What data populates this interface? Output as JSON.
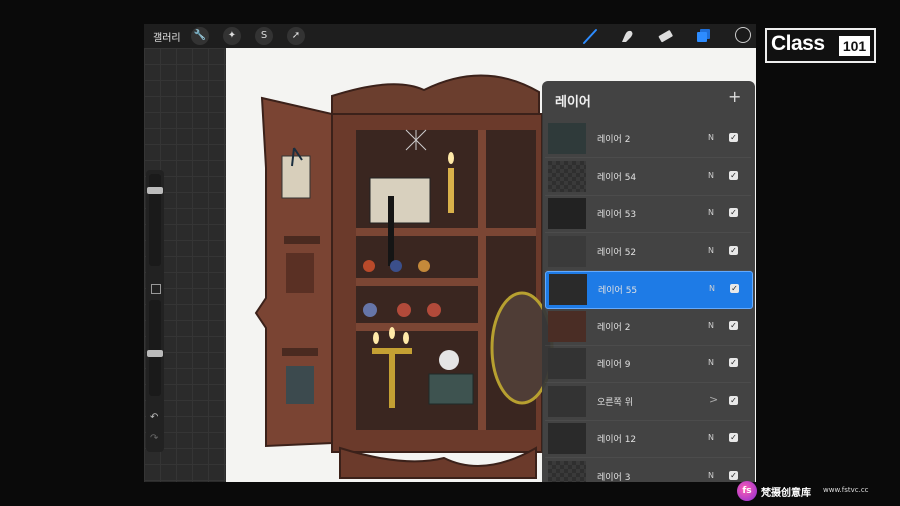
{
  "toolbar": {
    "gallery_label": "갤러리",
    "left_tools": [
      {
        "icon": "wrench-icon",
        "glyph": "🔧"
      },
      {
        "icon": "magic-wand-icon",
        "glyph": "✦"
      },
      {
        "icon": "selection-icon",
        "glyph": "S"
      },
      {
        "icon": "transform-arrow-icon",
        "glyph": "➚"
      }
    ],
    "right_tools": [
      "brush-icon",
      "smudge-icon",
      "eraser-icon",
      "layers-icon"
    ],
    "active_tool_color": "#2d8cff",
    "current_color": "#1a1a1a"
  },
  "layers_panel": {
    "title": "레이어",
    "add_label": "+",
    "layers": [
      {
        "name": "레이어 2",
        "blend": "N",
        "visible": true,
        "active": false,
        "thumb": "dark-teal"
      },
      {
        "name": "레이어 54",
        "blend": "N",
        "visible": true,
        "active": false,
        "thumb": "transparent"
      },
      {
        "name": "레이어 53",
        "blend": "N",
        "visible": true,
        "active": false,
        "thumb": "shirt"
      },
      {
        "name": "레이어 52",
        "blend": "N",
        "visible": true,
        "active": false,
        "thumb": "bottle"
      },
      {
        "name": "레이어 55",
        "blend": "N",
        "visible": true,
        "active": true,
        "thumb": "door"
      },
      {
        "name": "레이어 2",
        "blend": "N",
        "visible": true,
        "active": false,
        "thumb": "frame"
      },
      {
        "name": "레이어 9",
        "blend": "N",
        "visible": true,
        "active": false,
        "thumb": "sketch"
      },
      {
        "name": "오른쪽 위",
        "blend": ">",
        "visible": true,
        "active": false,
        "thumb": "group",
        "is_group": true
      },
      {
        "name": "레이어 12",
        "blend": "N",
        "visible": true,
        "active": false,
        "thumb": "line"
      },
      {
        "name": "레이어 3",
        "blend": "N",
        "visible": true,
        "active": false,
        "thumb": "transparent"
      }
    ]
  },
  "sidebar": {
    "brush_size": 0.85,
    "opacity": 0.45
  },
  "logo": {
    "text": "Class",
    "number": "101"
  },
  "watermark": {
    "icon_text": "fs",
    "cn": "梵摄创意库",
    "url": "www.fstvc.cc"
  }
}
